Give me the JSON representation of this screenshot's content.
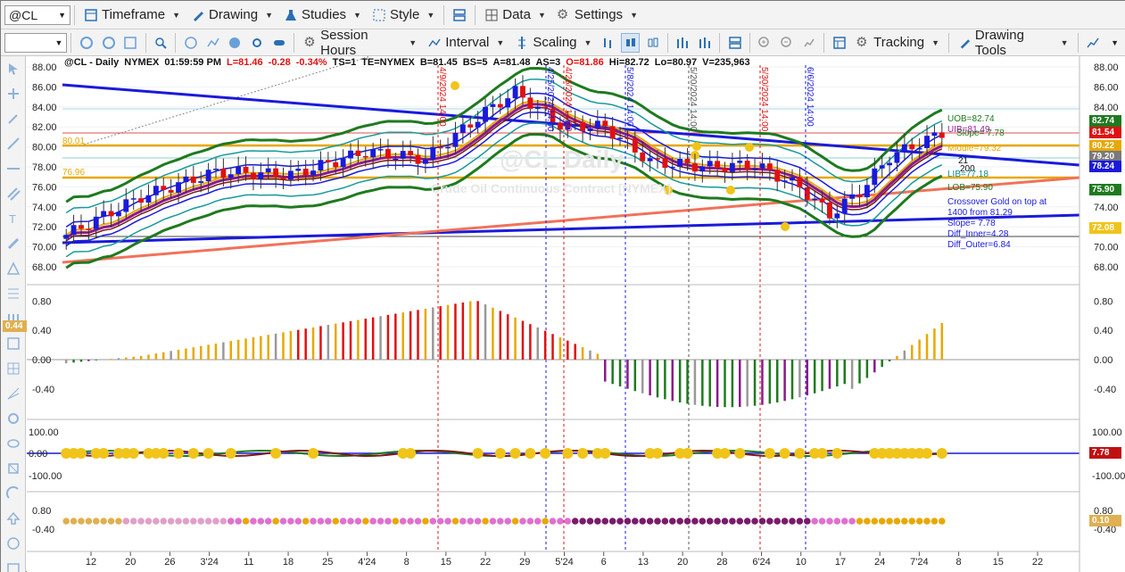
{
  "toolbar1": {
    "symbol": "@CL",
    "timeframe": "Timeframe",
    "drawing": "Drawing",
    "studies": "Studies",
    "style": "Style",
    "data": "Data",
    "settings": "Settings"
  },
  "toolbar2": {
    "session_hours": "Session Hours",
    "interval": "Interval",
    "scaling": "Scaling",
    "tracking": "Tracking",
    "drawing_tools": "Drawing Tools"
  },
  "header": {
    "symbol": "@CL - Daily",
    "exchange": "NYMEX",
    "time": "01:59:59 PM",
    "last": "L=81.46",
    "chg": "-0.28",
    "pct": "-0.34%",
    "ts": "TS=1",
    "te": "TE=NYMEX",
    "bid": "B=81.45",
    "bs": "BS=5",
    "ask": "A=81.48",
    "as": "AS=3",
    "open": "O=81.86",
    "hi": "Hi=82.72",
    "lo": "Lo=80.97",
    "vol": "V=235,963"
  },
  "watermark": {
    "main": "@CL Daily",
    "sub": "Crude Oil Continuous Contract [NYMEX]"
  },
  "price_axis": [
    "88.00",
    "86.00",
    "84.00",
    "82.00",
    "80.00",
    "78.00",
    "76.00",
    "74.00",
    "72.00",
    "70.00",
    "68.00"
  ],
  "price_tags": [
    {
      "text": "82.74",
      "color": "#1f7a1f"
    },
    {
      "text": "81.54",
      "color": "#e01010"
    },
    {
      "text": "80.22",
      "color": "#e8a800"
    },
    {
      "text": "79.20",
      "color": "#7a7a7a"
    },
    {
      "text": "78.24",
      "color": "#1a1adb"
    },
    {
      "text": "75.90",
      "color": "#1f7a1f"
    },
    {
      "text": "72.08",
      "color": "#f0c419"
    }
  ],
  "left_levels": {
    "upper": "80.01",
    "lower": "76.96"
  },
  "right_annotations": {
    "uob": "UOB=82.74",
    "slope_top": "Slope= 7.78",
    "uib": "UIB=81.49",
    "middle": "Middle=79.32",
    "l21": "21",
    "l200": "200",
    "lib": "LIB=77.18",
    "lob": "LOB=75.90",
    "crossover_1": "Crossover Gold on top at",
    "crossover_2": "1400 from 81.29",
    "slope": "Slope= 7.78",
    "diff_inner": "Diff_Inner=4.28",
    "diff_outer": "Diff_Outer=6.84"
  },
  "vertical_labels": [
    "4/9/2024 14:00",
    "4/25/2024 14:00",
    "4/26/2024 14:00",
    "5/8/2024 14:00",
    "5/20/2024 14:00",
    "5/30/2024 14:00",
    "6/6/2024 14:00"
  ],
  "macd_axis": [
    "0.80",
    "0.40",
    "0.00",
    "-0.40"
  ],
  "macd_tag": "0.44",
  "osc_axis": [
    "100.00",
    "0.00",
    "-100.00"
  ],
  "osc_tag": "7.78",
  "dot_axis": [
    "0.80",
    "-0.40"
  ],
  "dot_tag": "0.10",
  "date_axis": [
    "12",
    "20",
    "26",
    "3'24",
    "11",
    "18",
    "25",
    "4'24",
    "8",
    "15",
    "22",
    "29",
    "5'24",
    "6",
    "13",
    "20",
    "28",
    "6'24",
    "10",
    "17",
    "24",
    "7'24",
    "8",
    "15",
    "22"
  ],
  "chart_data": {
    "type": "candlestick",
    "title": "@CL - Daily NYMEX",
    "y_range": [
      67,
      89
    ],
    "series": [
      {
        "name": "UOB",
        "value": 82.74
      },
      {
        "name": "UIB",
        "value": 81.49
      },
      {
        "name": "Middle",
        "value": 79.32
      },
      {
        "name": "LIB",
        "value": 77.18
      },
      {
        "name": "LOB",
        "value": 75.9
      }
    ]
  }
}
